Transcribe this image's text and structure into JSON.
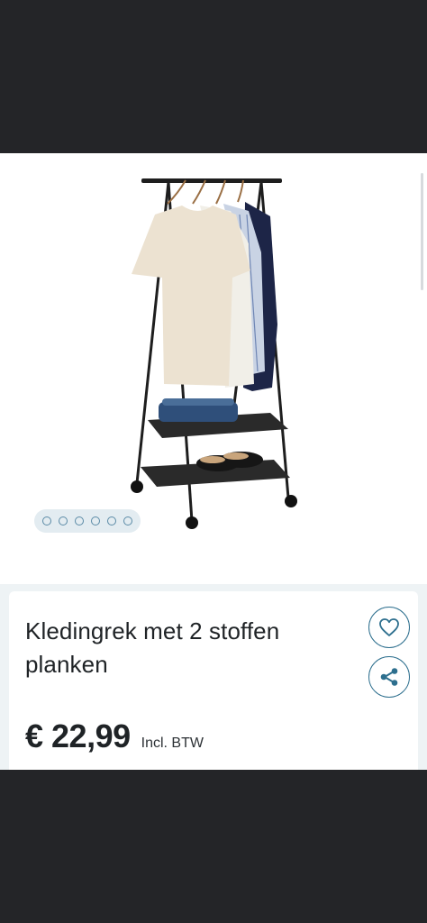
{
  "product": {
    "title": "Kledingrek met 2 stoffen planken",
    "price": "€ 22,99",
    "vat_label": "Incl. BTW"
  },
  "gallery": {
    "dot_count": 6
  },
  "actions": {
    "favorite_icon": "heart-icon",
    "share_icon": "share-icon"
  },
  "colors": {
    "accent": "#2d6f8e",
    "background_dark": "#242528",
    "dots_pill": "#e3ecf1"
  }
}
